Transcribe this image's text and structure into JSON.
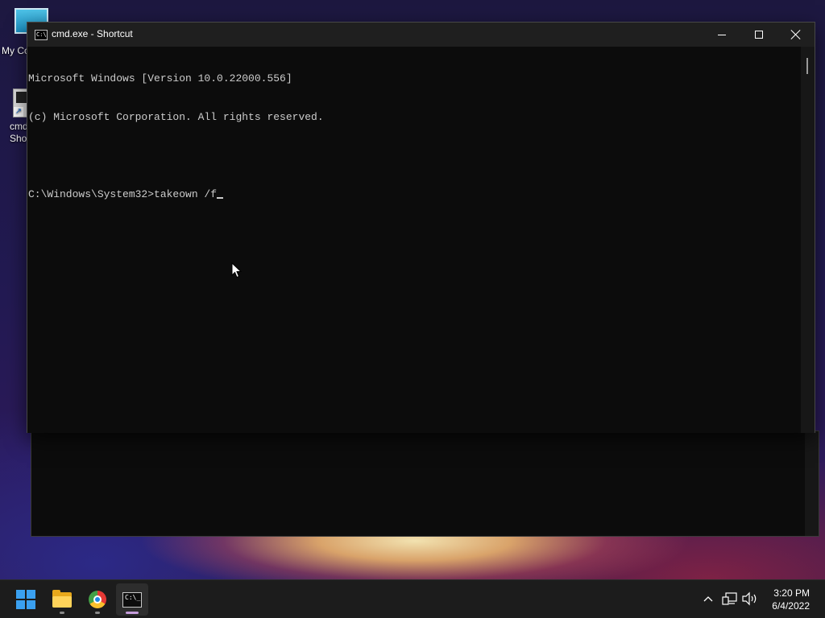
{
  "desktop": {
    "icons": [
      {
        "label": "My Co"
      },
      {
        "label": "cmd\nSho"
      }
    ]
  },
  "window": {
    "title": "cmd.exe - Shortcut",
    "icon_text": "C:\\",
    "buttons": [
      "minimize",
      "maximize",
      "close"
    ]
  },
  "console": {
    "lines": [
      "Microsoft Windows [Version 10.0.22000.556]",
      "(c) Microsoft Corporation. All rights reserved.",
      "",
      "C:\\Windows\\System32>takeown /f"
    ]
  },
  "taskbar": {
    "apps": [
      "Start",
      "File Explorer",
      "Google Chrome",
      "Command Prompt"
    ],
    "active_app": "Command Prompt",
    "cmd_icon_text": "C:\\_"
  },
  "clock": {
    "time": "3:20 PM",
    "date": "6/4/2022"
  },
  "colors": {
    "console_bg": "#0c0c0c",
    "console_text": "#cccccc",
    "titlebar": "#1f1f1f",
    "taskbar": "#1c1c1c"
  }
}
